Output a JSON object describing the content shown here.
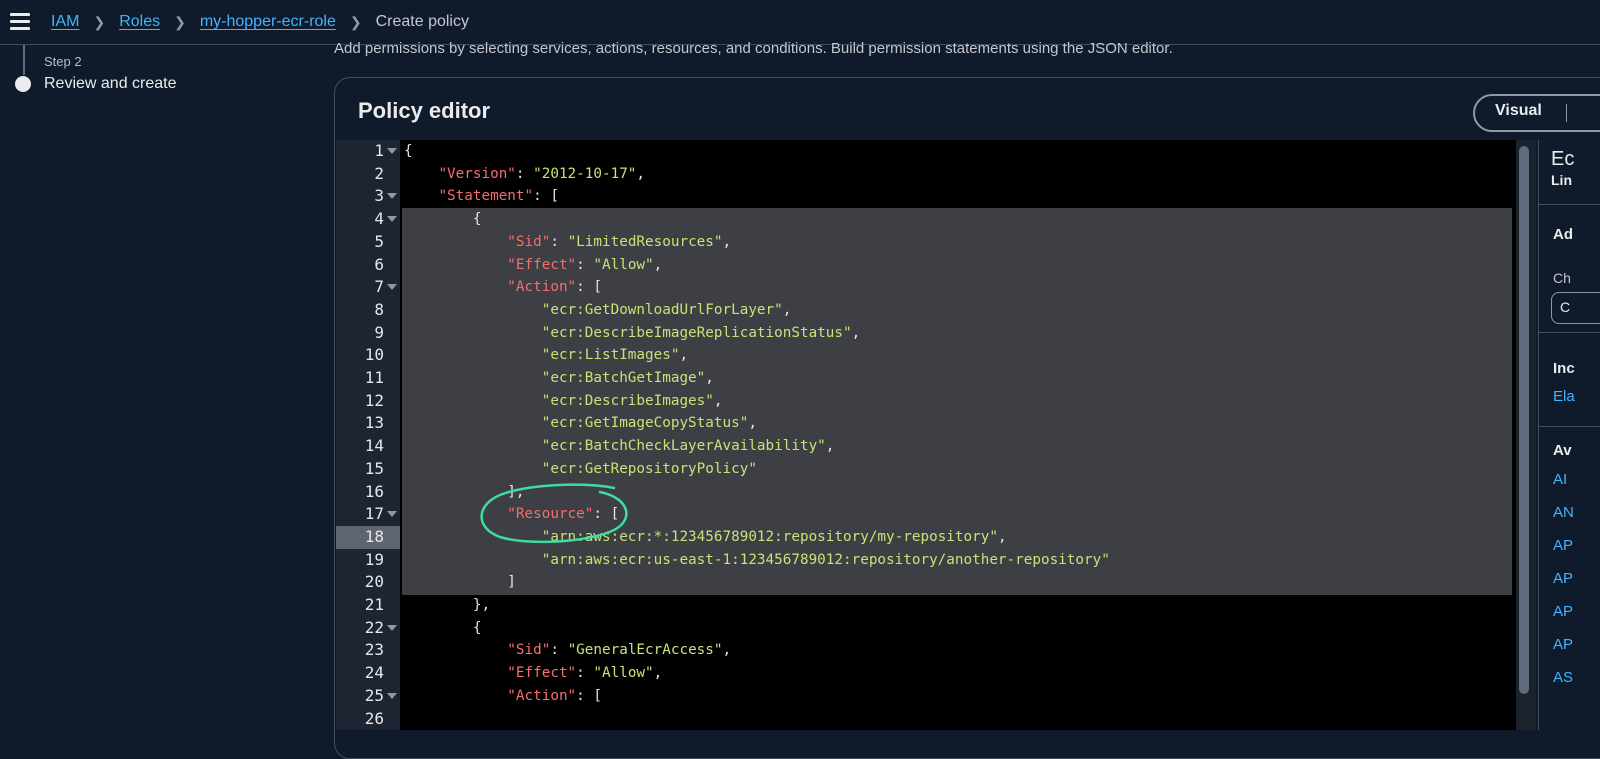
{
  "breadcrumb": {
    "items": [
      "IAM",
      "Roles",
      "my-hopper-ecr-role"
    ],
    "current": "Create policy"
  },
  "sidebar": {
    "step_label": "Step 2",
    "step_title": "Review and create"
  },
  "main": {
    "description": "Add permissions by selecting services, actions, resources, and conditions. Build permission statements using the JSON editor.",
    "panel_title": "Policy editor",
    "mode_visual": "Visual"
  },
  "editor": {
    "active_line": 18,
    "lines": [
      {
        "n": "1",
        "fold": true,
        "code": "{"
      },
      {
        "n": "2",
        "fold": false,
        "code": "    \"Version\": \"2012-10-17\","
      },
      {
        "n": "3",
        "fold": true,
        "code": "    \"Statement\": ["
      },
      {
        "n": "4",
        "fold": true,
        "code": "        {"
      },
      {
        "n": "5",
        "fold": false,
        "code": "            \"Sid\": \"LimitedResources\","
      },
      {
        "n": "6",
        "fold": false,
        "code": "            \"Effect\": \"Allow\","
      },
      {
        "n": "7",
        "fold": true,
        "code": "            \"Action\": ["
      },
      {
        "n": "8",
        "fold": false,
        "code": "                \"ecr:GetDownloadUrlForLayer\","
      },
      {
        "n": "9",
        "fold": false,
        "code": "                \"ecr:DescribeImageReplicationStatus\","
      },
      {
        "n": "10",
        "fold": false,
        "code": "                \"ecr:ListImages\","
      },
      {
        "n": "11",
        "fold": false,
        "code": "                \"ecr:BatchGetImage\","
      },
      {
        "n": "12",
        "fold": false,
        "code": "                \"ecr:DescribeImages\","
      },
      {
        "n": "13",
        "fold": false,
        "code": "                \"ecr:GetImageCopyStatus\","
      },
      {
        "n": "14",
        "fold": false,
        "code": "                \"ecr:BatchCheckLayerAvailability\","
      },
      {
        "n": "15",
        "fold": false,
        "code": "                \"ecr:GetRepositoryPolicy\""
      },
      {
        "n": "16",
        "fold": false,
        "code": "            ],"
      },
      {
        "n": "17",
        "fold": true,
        "code": "            \"Resource\": ["
      },
      {
        "n": "18",
        "fold": false,
        "code": "                \"arn:aws:ecr:*:123456789012:repository/my-repository\","
      },
      {
        "n": "19",
        "fold": false,
        "code": "                \"arn:aws:ecr:us-east-1:123456789012:repository/another-repository\""
      },
      {
        "n": "20",
        "fold": false,
        "code": "            ]"
      },
      {
        "n": "21",
        "fold": false,
        "code": "        },"
      },
      {
        "n": "22",
        "fold": true,
        "code": "        {"
      },
      {
        "n": "23",
        "fold": false,
        "code": "            \"Sid\": \"GeneralEcrAccess\","
      },
      {
        "n": "24",
        "fold": false,
        "code": "            \"Effect\": \"Allow\","
      },
      {
        "n": "25",
        "fold": true,
        "code": "            \"Action\": ["
      },
      {
        "n": "26",
        "fold": false,
        "code": ""
      }
    ]
  },
  "right_panel": {
    "title": "Ec",
    "subtitle": "Lin",
    "add_label": "Ad",
    "choose_label": "Ch",
    "choose_button": "C",
    "included_label": "Inc",
    "included_link": "Ela",
    "available_label": "Av",
    "service_links": [
      "AI",
      "AN",
      "AP",
      "AP",
      "AP",
      "AP",
      "AS"
    ]
  },
  "colors": {
    "key": "#f66d6d",
    "string": "#c5e478",
    "link": "#42b4ff",
    "annotation": "#3fdca0"
  }
}
